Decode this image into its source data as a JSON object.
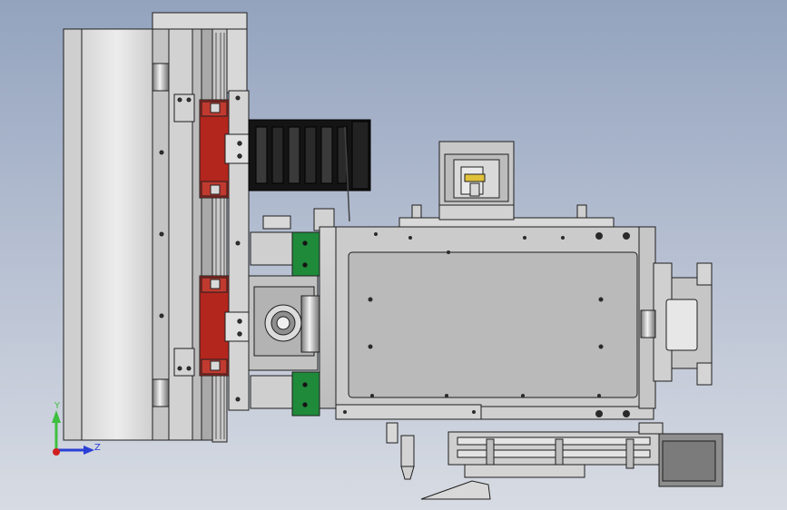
{
  "triad": {
    "y_label": "Y",
    "z_label": "Z",
    "y_color": "#3fbf3f",
    "z_color": "#2a3fd6",
    "x_color": "#d02020"
  },
  "colors": {
    "background_top": "#93a3be",
    "background_bottom": "#d7dbe3",
    "metal_light": "#e3e3e3",
    "metal_mid": "#c8c8c8",
    "metal_dark": "#9a9a9a",
    "edge": "#1e1e1e",
    "slider_red": "#b3261e",
    "rail_green": "#1f8a3a",
    "drag_chain": "#121212",
    "bracket_yellow": "#e0c23a"
  }
}
